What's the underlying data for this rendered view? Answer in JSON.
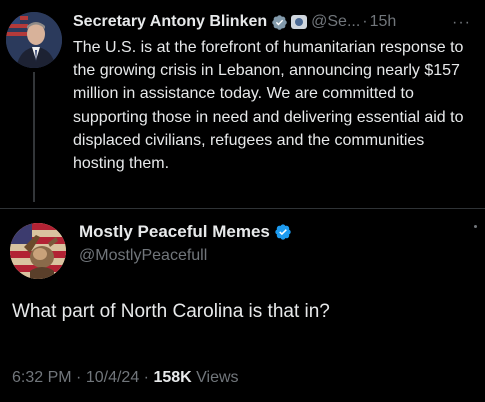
{
  "tweet1": {
    "author_name": "Secretary Antony Blinken",
    "handle": "@Se...",
    "separator": "·",
    "time": "15h",
    "more": "···",
    "text": "The U.S. is at the forefront of humanitarian response to the growing crisis in Lebanon, announcing nearly $157 million in assistance today. We are committed to supporting those in need and delivering essential aid to displaced civilians, refugees and the communities hosting them."
  },
  "tweet2": {
    "author_name": "Mostly Peaceful Memes",
    "handle": "@MostlyPeacefull",
    "text": "What part of North Carolina is that in?",
    "time": "6:32 PM",
    "separator": "·",
    "date": "10/4/24",
    "views_count": "158K",
    "views_label": "Views"
  },
  "colors": {
    "background": "#000000",
    "text_primary": "#e7e9ea",
    "text_secondary": "#71767b",
    "verified_blue": "#1d9bf0",
    "verified_gray": "#829aab",
    "divider": "#2f3336"
  },
  "icons": {
    "verified_gray": "gray-verified-badge-icon",
    "government_flag": "government-affiliation-icon",
    "verified_blue": "blue-verified-badge-icon",
    "more": "more-options-icon"
  }
}
